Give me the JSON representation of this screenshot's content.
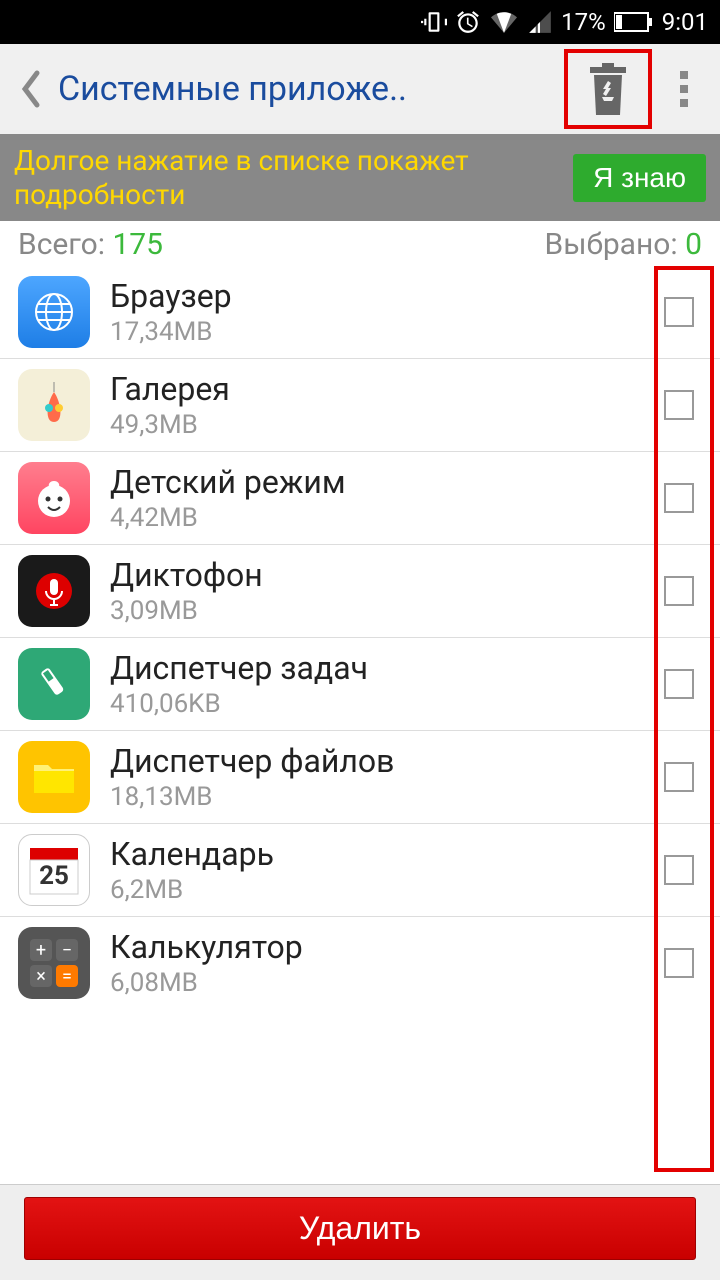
{
  "status": {
    "battery": "17%",
    "time": "9:01"
  },
  "header": {
    "title": "Системные приложе.."
  },
  "tip": {
    "text": "Долгое нажатие в списке покажет подробности",
    "button": "Я знаю"
  },
  "counts": {
    "total_label": "Всего: ",
    "total": "175",
    "selected_label": "Выбрано: ",
    "selected": "0"
  },
  "apps": [
    {
      "name": "Браузер",
      "size": "17,34MB"
    },
    {
      "name": "Галерея",
      "size": "49,3MB"
    },
    {
      "name": "Детский режим",
      "size": "4,42MB"
    },
    {
      "name": "Диктофон",
      "size": "3,09MB"
    },
    {
      "name": "Диспетчер задач",
      "size": "410,06KB"
    },
    {
      "name": "Диспетчер файлов",
      "size": "18,13MB"
    },
    {
      "name": "Календарь",
      "size": "6,2MB"
    },
    {
      "name": "Калькулятор",
      "size": "6,08MB"
    }
  ],
  "footer": {
    "delete": "Удалить"
  }
}
